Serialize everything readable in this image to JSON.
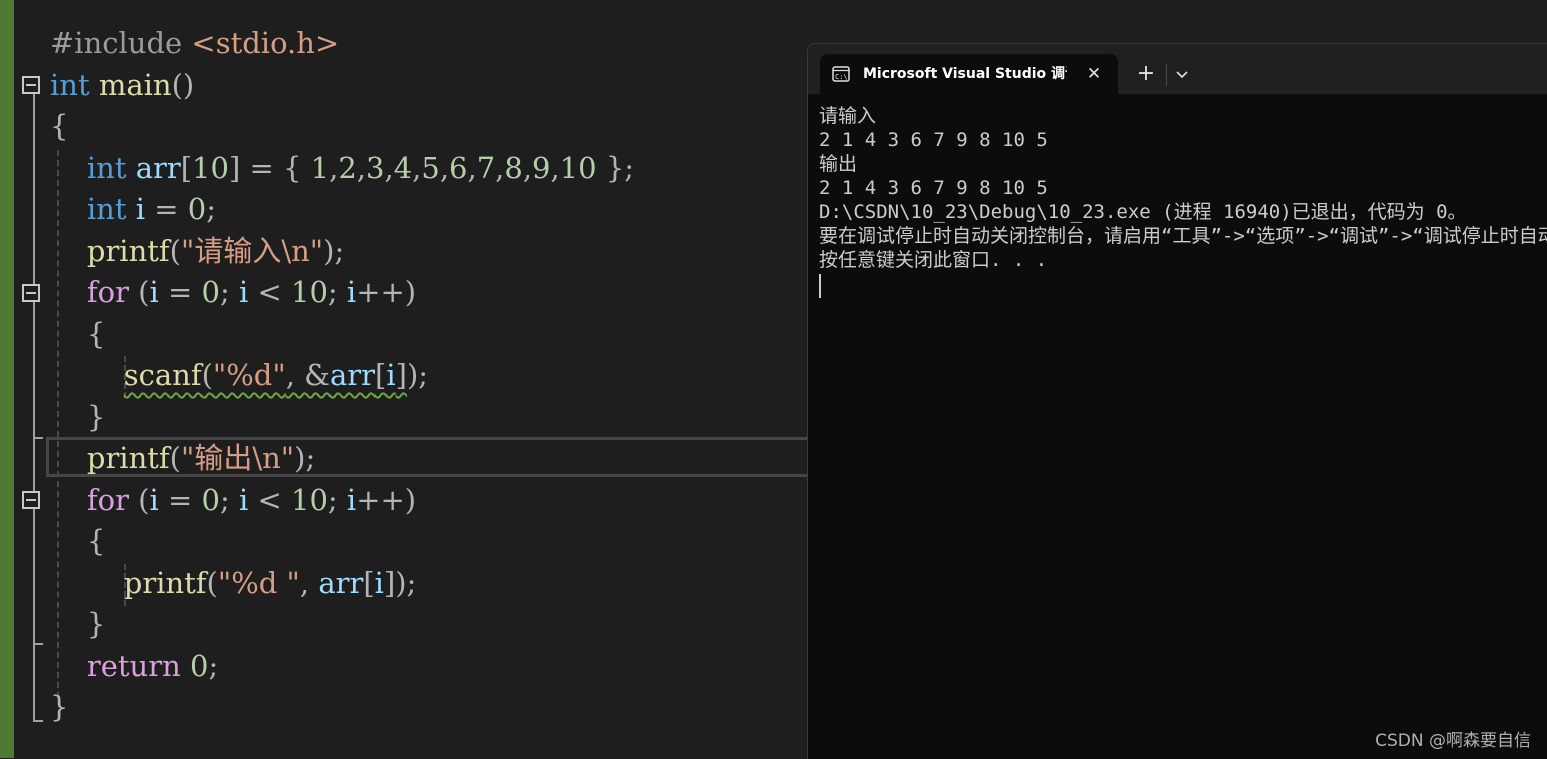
{
  "editor": {
    "lines": [
      [
        {
          "t": "#include ",
          "c": "pp"
        },
        {
          "t": "<stdio.h>",
          "c": "ppstr"
        }
      ],
      [
        {
          "t": "int",
          "c": "kw"
        },
        {
          "t": " "
        },
        {
          "t": "main",
          "c": "fn"
        },
        {
          "t": "()",
          "c": "pun"
        }
      ],
      [
        {
          "t": "{",
          "c": "pun"
        }
      ],
      [
        {
          "t": "    "
        },
        {
          "t": "int",
          "c": "kw"
        },
        {
          "t": " "
        },
        {
          "t": "arr",
          "c": "var"
        },
        {
          "t": "[",
          "c": "pun"
        },
        {
          "t": "10",
          "c": "num"
        },
        {
          "t": "] = { ",
          "c": "pun"
        },
        {
          "t": "1",
          "c": "num"
        },
        {
          "t": ",",
          "c": "pun"
        },
        {
          "t": "2",
          "c": "num"
        },
        {
          "t": ",",
          "c": "pun"
        },
        {
          "t": "3",
          "c": "num"
        },
        {
          "t": ",",
          "c": "pun"
        },
        {
          "t": "4",
          "c": "num"
        },
        {
          "t": ",",
          "c": "pun"
        },
        {
          "t": "5",
          "c": "num"
        },
        {
          "t": ",",
          "c": "pun"
        },
        {
          "t": "6",
          "c": "num"
        },
        {
          "t": ",",
          "c": "pun"
        },
        {
          "t": "7",
          "c": "num"
        },
        {
          "t": ",",
          "c": "pun"
        },
        {
          "t": "8",
          "c": "num"
        },
        {
          "t": ",",
          "c": "pun"
        },
        {
          "t": "9",
          "c": "num"
        },
        {
          "t": ",",
          "c": "pun"
        },
        {
          "t": "10",
          "c": "num"
        },
        {
          "t": " };",
          "c": "pun"
        }
      ],
      [
        {
          "t": "    "
        },
        {
          "t": "int",
          "c": "kw"
        },
        {
          "t": " "
        },
        {
          "t": "i",
          "c": "var"
        },
        {
          "t": " = ",
          "c": "pun"
        },
        {
          "t": "0",
          "c": "num"
        },
        {
          "t": ";",
          "c": "pun"
        }
      ],
      [
        {
          "t": "    "
        },
        {
          "t": "printf",
          "c": "fn"
        },
        {
          "t": "(",
          "c": "pun"
        },
        {
          "t": "\"请输入\\n\"",
          "c": "str"
        },
        {
          "t": ");",
          "c": "pun"
        }
      ],
      [
        {
          "t": "    "
        },
        {
          "t": "for",
          "c": "ctl"
        },
        {
          "t": " (",
          "c": "pun"
        },
        {
          "t": "i",
          "c": "var"
        },
        {
          "t": " = ",
          "c": "pun"
        },
        {
          "t": "0",
          "c": "num"
        },
        {
          "t": "; ",
          "c": "pun"
        },
        {
          "t": "i",
          "c": "var"
        },
        {
          "t": " < ",
          "c": "pun"
        },
        {
          "t": "10",
          "c": "num"
        },
        {
          "t": "; ",
          "c": "pun"
        },
        {
          "t": "i",
          "c": "var"
        },
        {
          "t": "++)",
          "c": "pun"
        }
      ],
      [
        {
          "t": "    "
        },
        {
          "t": "{",
          "c": "pun"
        }
      ],
      [
        {
          "t": "        "
        },
        {
          "t": "scanf",
          "c": "fn sq"
        },
        {
          "t": "(",
          "c": "pun sq"
        },
        {
          "t": "\"%d\"",
          "c": "str sq"
        },
        {
          "t": ", &",
          "c": "pun sq"
        },
        {
          "t": "arr",
          "c": "var sq"
        },
        {
          "t": "[",
          "c": "pun sq"
        },
        {
          "t": "i",
          "c": "var sq"
        },
        {
          "t": "]",
          "c": "pun sq"
        },
        {
          "t": ");",
          "c": "pun"
        }
      ],
      [
        {
          "t": "    "
        },
        {
          "t": "}",
          "c": "pun"
        }
      ],
      [
        {
          "t": "    "
        },
        {
          "t": "printf",
          "c": "fn"
        },
        {
          "t": "(",
          "c": "pun"
        },
        {
          "t": "\"输出\\n\"",
          "c": "str"
        },
        {
          "t": ");",
          "c": "pun"
        }
      ],
      [
        {
          "t": "    "
        },
        {
          "t": "for",
          "c": "ctl"
        },
        {
          "t": " (",
          "c": "pun"
        },
        {
          "t": "i",
          "c": "var"
        },
        {
          "t": " = ",
          "c": "pun"
        },
        {
          "t": "0",
          "c": "num"
        },
        {
          "t": "; ",
          "c": "pun"
        },
        {
          "t": "i",
          "c": "var"
        },
        {
          "t": " < ",
          "c": "pun"
        },
        {
          "t": "10",
          "c": "num"
        },
        {
          "t": "; ",
          "c": "pun"
        },
        {
          "t": "i",
          "c": "var"
        },
        {
          "t": "++)",
          "c": "pun"
        }
      ],
      [
        {
          "t": "    "
        },
        {
          "t": "{",
          "c": "pun"
        }
      ],
      [
        {
          "t": "        "
        },
        {
          "t": "printf",
          "c": "fn"
        },
        {
          "t": "(",
          "c": "pun"
        },
        {
          "t": "\"%d \"",
          "c": "str"
        },
        {
          "t": ", ",
          "c": "pun"
        },
        {
          "t": "arr",
          "c": "var"
        },
        {
          "t": "[",
          "c": "pun"
        },
        {
          "t": "i",
          "c": "var"
        },
        {
          "t": "]);",
          "c": "pun"
        }
      ],
      [
        {
          "t": "    "
        },
        {
          "t": "}",
          "c": "pun"
        }
      ],
      [
        {
          "t": "    "
        },
        {
          "t": "return",
          "c": "ctl"
        },
        {
          "t": " "
        },
        {
          "t": "0",
          "c": "num"
        },
        {
          "t": ";",
          "c": "pun"
        }
      ],
      [
        {
          "t": "}",
          "c": "pun"
        }
      ]
    ]
  },
  "console": {
    "tab_title": "Microsoft Visual Studio 调试控制台",
    "tab_close": "✕",
    "new_tab": "+",
    "output": [
      "请输入",
      "2 1 4 3 6 7 9 8 10 5",
      "输出",
      "2 1 4 3 6 7 9 8 10 5",
      "D:\\CSDN\\10_23\\Debug\\10_23.exe (进程 16940)已退出，代码为 0。",
      "要在调试停止时自动关闭控制台，请启用“工具”->“选项”->“调试”->“调试停止时自动关闭控制台”。",
      "按任意键关闭此窗口. . ."
    ]
  },
  "watermark": "CSDN @啊森要自信",
  "colors": {
    "editor_bg": "#1e1e1e",
    "keyword": "#569cd6",
    "control": "#d8a0df",
    "function": "#dcdcaa",
    "string": "#d69d85",
    "number": "#b5cea8",
    "console_bg": "#0c0c0c"
  }
}
